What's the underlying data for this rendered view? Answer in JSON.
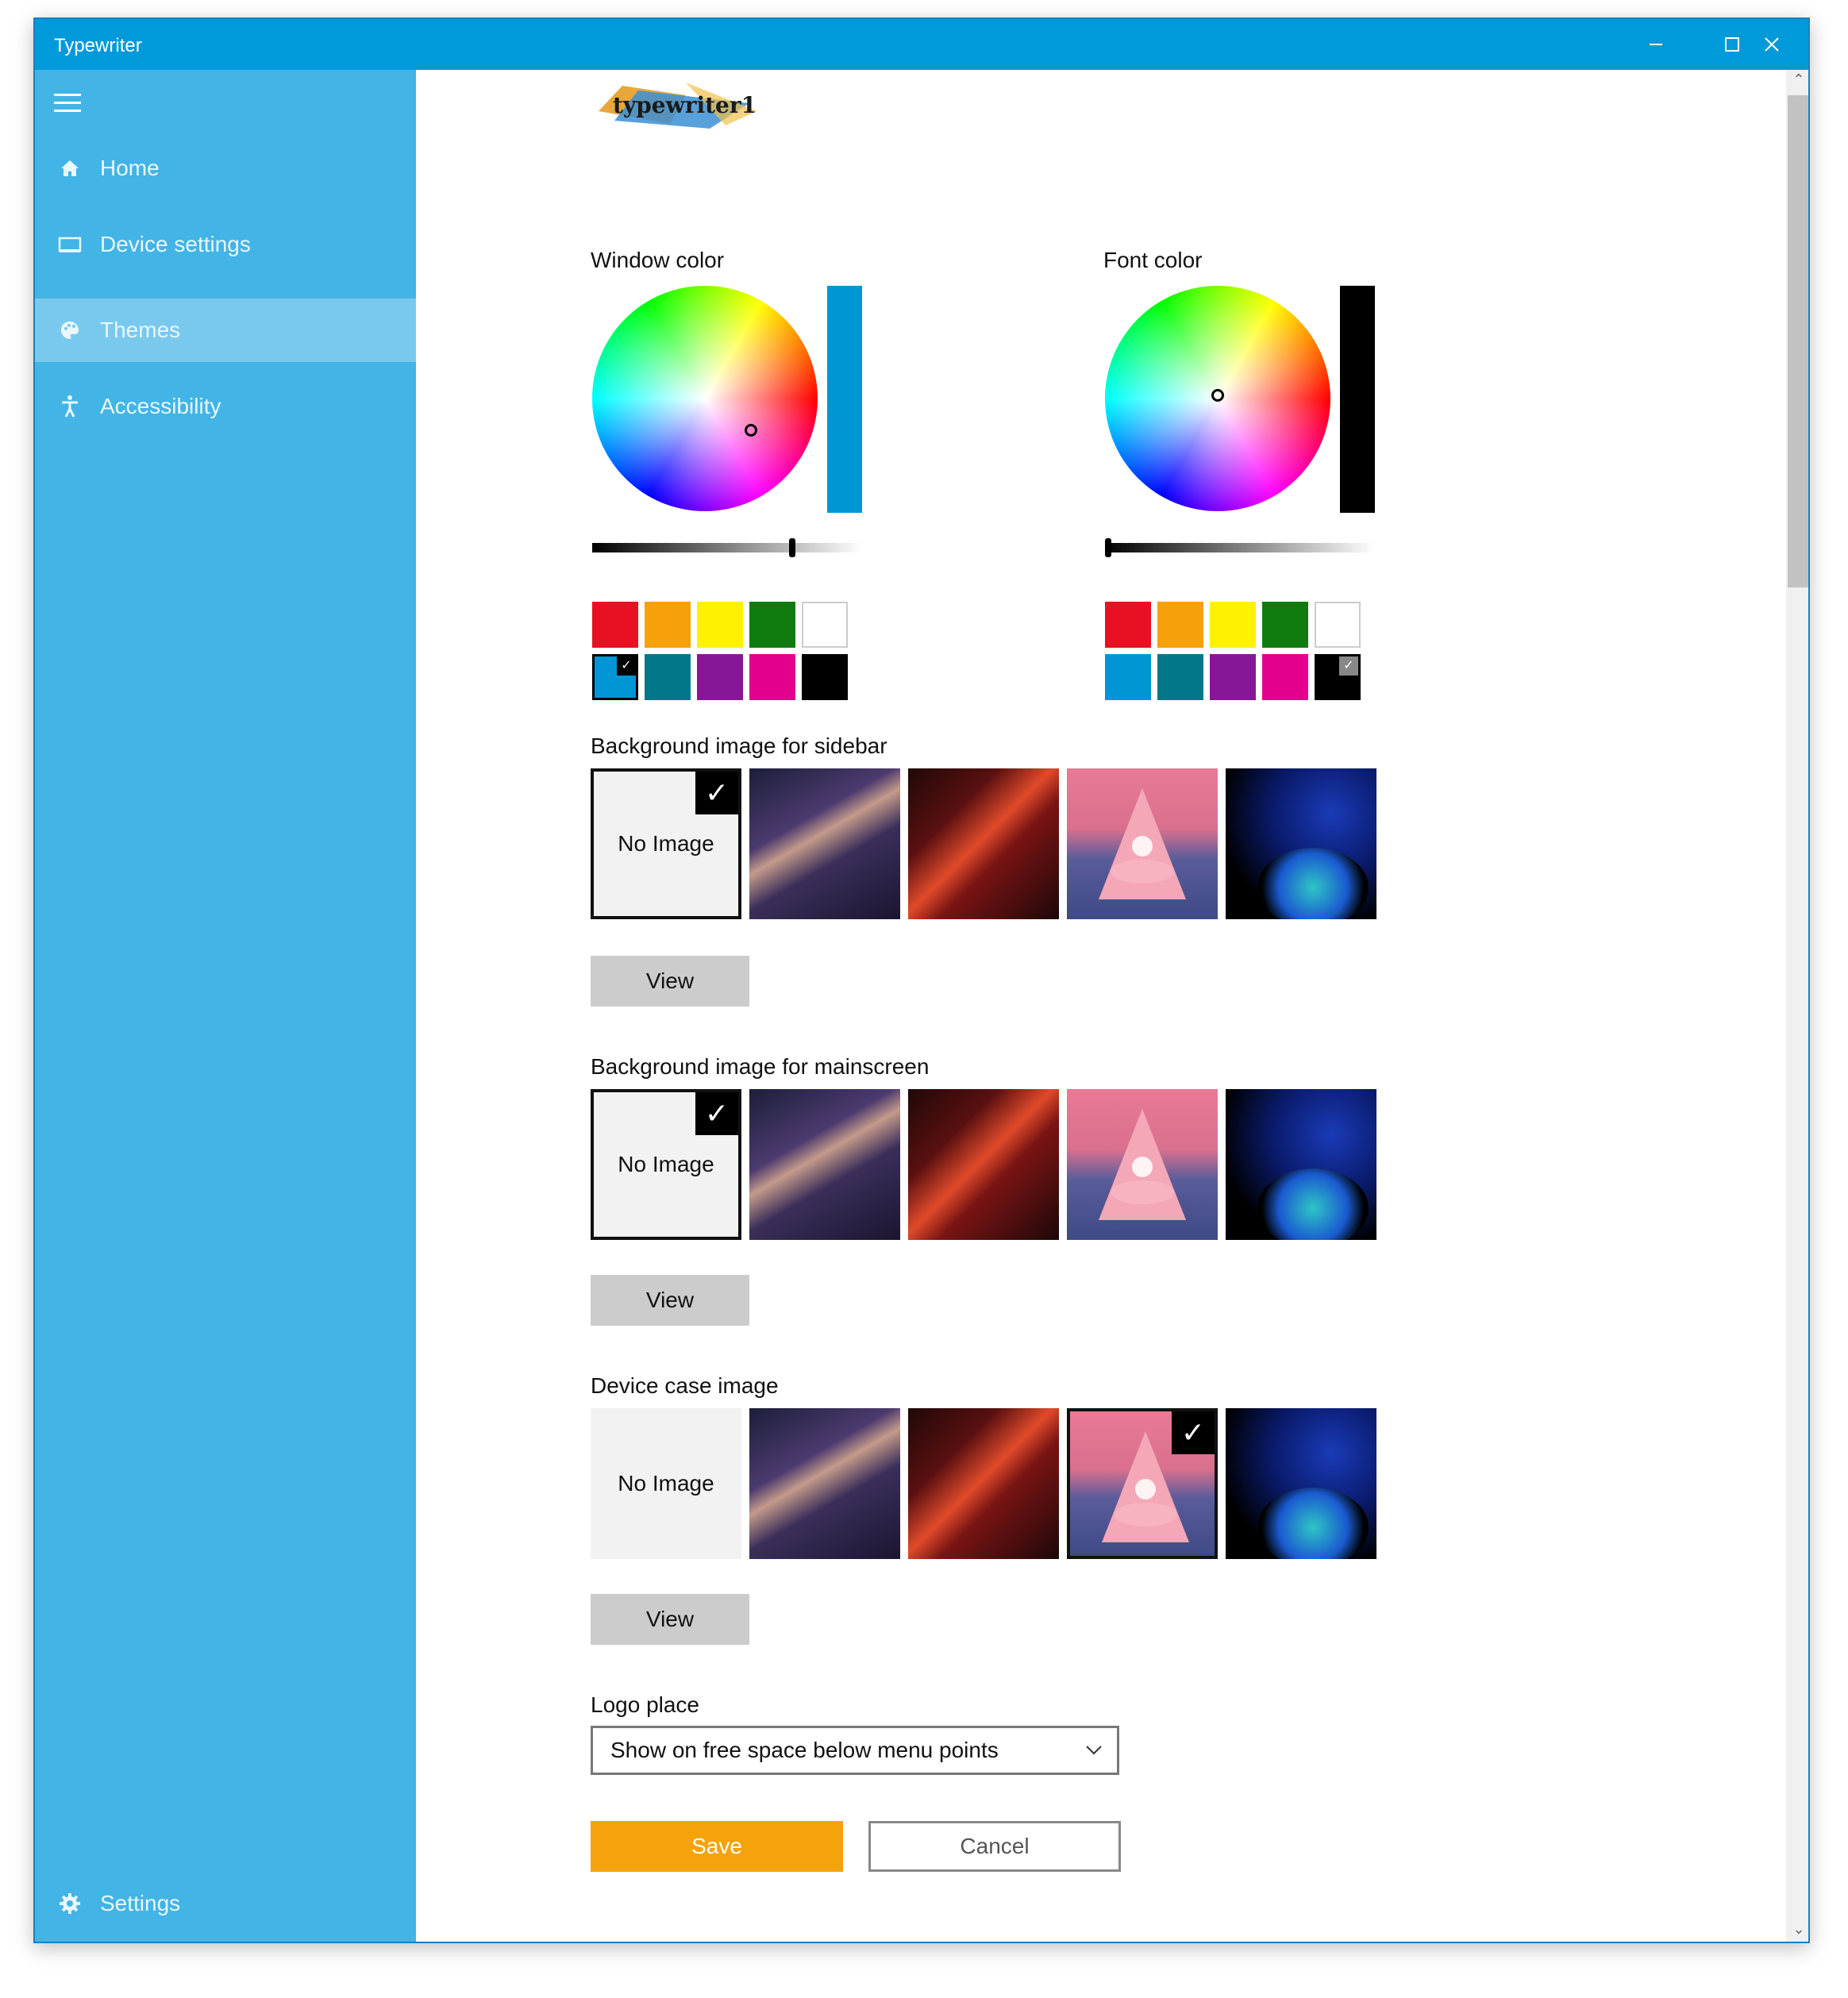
{
  "window": {
    "title": "Typewriter"
  },
  "sidebar": {
    "items": [
      {
        "label": "Home",
        "icon": "home-icon"
      },
      {
        "label": "Device settings",
        "icon": "device-icon"
      },
      {
        "label": "Themes",
        "icon": "palette-icon",
        "active": true
      },
      {
        "label": "Accessibility",
        "icon": "accessibility-icon"
      }
    ],
    "footer": {
      "label": "Settings",
      "icon": "gear-icon"
    }
  },
  "logo": {
    "text": "typewriter1"
  },
  "window_color": {
    "label": "Window color",
    "current": "#0096d6",
    "swatches": [
      "#e81123",
      "#f7a10a",
      "#fff200",
      "#107c10",
      "#ffffff",
      "#0096d6",
      "#00788a",
      "#881798",
      "#e3008c",
      "#000000"
    ],
    "selected_index": 5
  },
  "font_color": {
    "label": "Font color",
    "current": "#000000",
    "swatches": [
      "#e81123",
      "#f7a10a",
      "#fff200",
      "#107c10",
      "#ffffff",
      "#0096d6",
      "#00788a",
      "#881798",
      "#e3008c",
      "#000000"
    ],
    "selected_index": 9
  },
  "sidebar_bg": {
    "label": "Background image for sidebar",
    "no_image_label": "No Image",
    "selected_index": 0,
    "view_label": "View"
  },
  "mainscreen_bg": {
    "label": "Background image for mainscreen",
    "no_image_label": "No Image",
    "selected_index": 0,
    "view_label": "View"
  },
  "device_case": {
    "label": "Device case image",
    "no_image_label": "No Image",
    "selected_index": 3,
    "view_label": "View"
  },
  "logo_place": {
    "label": "Logo place",
    "value": "Show on free space below menu points"
  },
  "actions": {
    "save_label": "Save",
    "cancel_label": "Cancel"
  },
  "colors": {
    "titlebar": "#0099d9",
    "sidebar": "#42b4e6",
    "sidebar_active": "#79c9ee",
    "save": "#f4a30a"
  }
}
